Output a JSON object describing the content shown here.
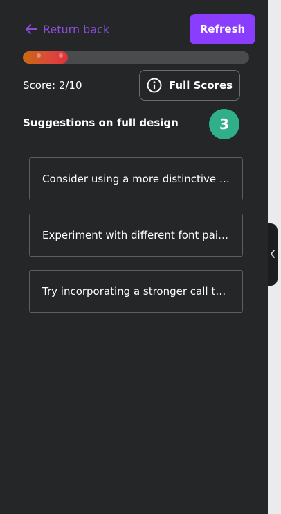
{
  "header": {
    "back_label": "Return back",
    "refresh_label": "Refresh"
  },
  "score": {
    "text": "Score: 2/10",
    "progress_fraction": 0.2,
    "full_scores_label": "Full Scores"
  },
  "suggestions": {
    "heading": "Suggestions on full design",
    "count": "3",
    "items": [
      {
        "text": "Consider using a more distinctive …"
      },
      {
        "text": "Experiment with different font pai…"
      },
      {
        "text": "Try incorporating a stronger call t…"
      }
    ]
  },
  "colors": {
    "panel_bg": "#252627",
    "accent_purple": "#8b3dff",
    "badge_green": "#2fb08b",
    "progress_start": "#c96a10",
    "progress_end": "#e0323a"
  },
  "icons": {
    "back": "arrow-left-icon",
    "info": "info-icon",
    "collapse": "chevron-left-icon"
  }
}
